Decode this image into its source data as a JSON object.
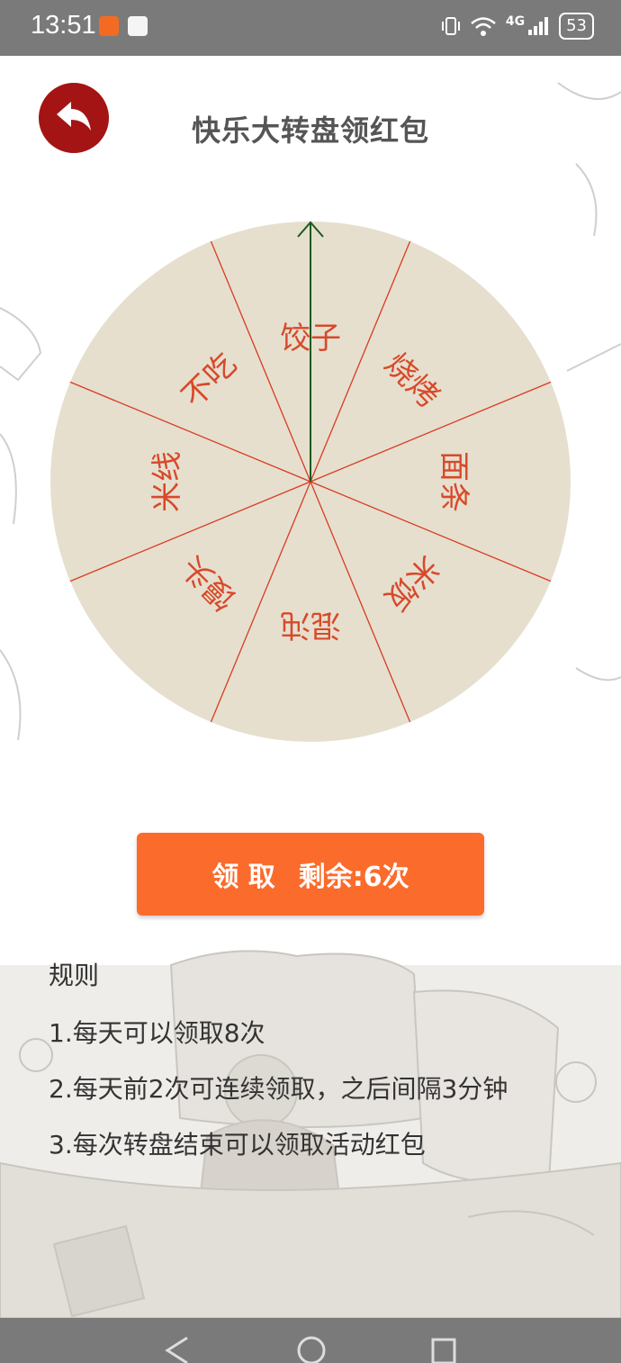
{
  "status_bar": {
    "time": "13:51",
    "signal": "4G",
    "battery": "53",
    "icons": [
      "vibrate-icon",
      "wifi-icon",
      "signal-icon"
    ]
  },
  "header": {
    "title": "快乐大转盘领红包",
    "back_icon": "back-arrow-icon"
  },
  "wheel": {
    "segments": [
      "饺子",
      "烧烤",
      "面条",
      "米饭",
      "混沌",
      "馒头",
      "米线",
      "不吃"
    ],
    "fill_color": "#e6dfce",
    "divider_color": "#d93a22",
    "text_color": "#d8492a",
    "pointer_color": "#1d5b1d"
  },
  "claim_button": {
    "label": "领 取",
    "remaining": "剩余:6次",
    "color": "#fb6b2b"
  },
  "rules": {
    "heading": "规则",
    "items": [
      "1.每天可以领取8次",
      "2.每天前2次可连续领取，之后间隔3分钟",
      "3.每次转盘结束可以领取活动红包"
    ]
  },
  "nav_bar": {
    "buttons": [
      "back-nav-icon",
      "home-nav-icon",
      "recents-nav-icon"
    ]
  }
}
